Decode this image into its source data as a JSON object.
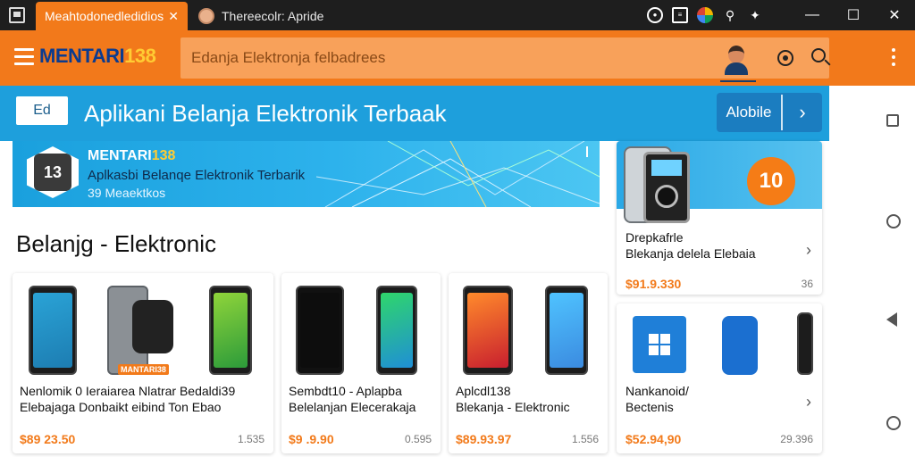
{
  "window": {
    "tabs": [
      {
        "label": "Meahtodonedledidios",
        "active": true
      },
      {
        "label": "Thereecolr: Apride",
        "active": false
      }
    ],
    "controls": {
      "minimize": "—",
      "maximize": "☐",
      "close": "✕"
    }
  },
  "header": {
    "logo_text": "MENTARI",
    "logo_number": "138",
    "search_placeholder": "Edanja Elektronja felbadrees"
  },
  "strip": {
    "edit_label": "Ed",
    "title": "Aplikani Belanja Elektronik Terbaak",
    "button_label": "Alobile",
    "button_chevron": "›"
  },
  "banner": {
    "badge_text": "13",
    "brand": "MENTARI",
    "brand_number": "138",
    "subtitle": "Aplkasbi Belanqe Elektronik Terbarik",
    "meta": "39 Meaektkos"
  },
  "featured": {
    "circle_text": "10",
    "name": "Drepkafrle",
    "desc": "Blekanja delela Elebaia",
    "price": "$91.9.330",
    "count": "36"
  },
  "section_title": "Belanjg - Elektronic",
  "products": [
    {
      "title": "Nenlomik 0 Ieraiarea Nlatrar Bedaldi39",
      "sub": "Elebajaga Donbaikt eibind Ton Ebao",
      "price": "$89 23.50",
      "count": "1.535",
      "badge": "MANTARI38"
    },
    {
      "title": "Sembdt10 - Aplapba",
      "sub": "Belelanjan Elecerakaja",
      "price": "$9 .9.90",
      "count": "0.595"
    },
    {
      "title": "Aplcdl138",
      "sub": "Blekanja - Elektronic",
      "price": "$89.93.97",
      "count": "1.556"
    }
  ],
  "mini_card": {
    "title": "Nankanoid/",
    "sub": "Bectenis",
    "price": "$52.94,90",
    "count": "29.396"
  },
  "colors": {
    "brand_orange": "#f2791b",
    "brand_blue": "#1e9fdc",
    "price_orange": "#f27a1a"
  },
  "icons": [
    "menu-icon",
    "profile-icon",
    "eye-icon",
    "search-icon",
    "more-icon",
    "chevron-right-icon",
    "square-nav-icon",
    "circle-home-icon",
    "triangle-back-icon"
  ]
}
